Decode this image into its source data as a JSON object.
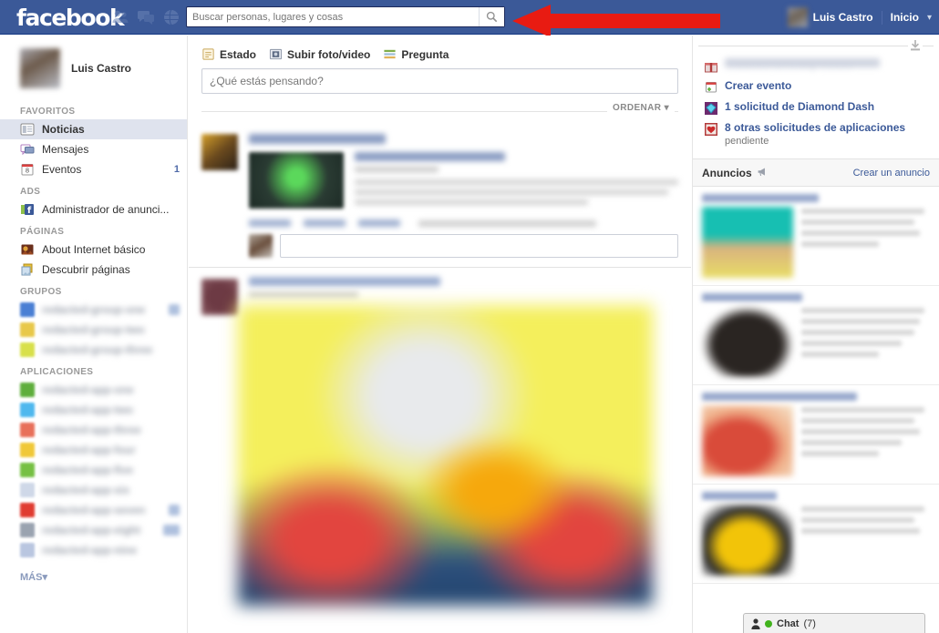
{
  "header": {
    "logo": "facebook",
    "icons": [
      "friends-icon",
      "messages-icon",
      "globe-notifications-icon"
    ],
    "search": {
      "placeholder": "Buscar personas, lugares y cosas",
      "value": "",
      "button_icon": "search-icon"
    },
    "account": {
      "name": "Luis Castro",
      "home_label": "Inicio",
      "caret": "▾"
    },
    "annotation": {
      "type": "red-arrow",
      "points_to": "search-input",
      "color": "#e81b12"
    }
  },
  "sidebar": {
    "profile_name": "Luis Castro",
    "sections": [
      {
        "label": "FAVORITOS",
        "items": [
          {
            "label": "Noticias",
            "icon": "newsfeed-icon",
            "active": true,
            "badge": ""
          },
          {
            "label": "Mensajes",
            "icon": "messages-icon",
            "active": false,
            "badge": ""
          },
          {
            "label": "Eventos",
            "icon": "calendar-icon",
            "active": false,
            "badge": "1"
          }
        ]
      },
      {
        "label": "ADS",
        "items": [
          {
            "label": "Administrador de anunci...",
            "icon": "ads-manager-icon",
            "active": false,
            "badge": ""
          }
        ]
      },
      {
        "label": "PÁGINAS",
        "items": [
          {
            "label": "About Internet básico",
            "icon": "page-thumb-icon",
            "active": false,
            "badge": ""
          },
          {
            "label": "Descubrir páginas",
            "icon": "discover-pages-icon",
            "active": false,
            "badge": ""
          }
        ]
      },
      {
        "label": "GRUPOS",
        "redacted": true,
        "items": [
          {
            "label": "redacted-group-one",
            "icon": "group-icon",
            "swatch": "#4a7fd4",
            "badge": "1"
          },
          {
            "label": "redacted-group-two",
            "icon": "group-icon",
            "swatch": "#e8c84a",
            "badge": ""
          },
          {
            "label": "redacted-group-three",
            "icon": "group-icon",
            "swatch": "#d8e04a",
            "badge": ""
          }
        ]
      },
      {
        "label": "APLICACIONES",
        "redacted": true,
        "items": [
          {
            "label": "redacted-app-one",
            "icon": "app-icon",
            "swatch": "#5fae3c",
            "badge": ""
          },
          {
            "label": "redacted-app-two",
            "icon": "app-icon",
            "swatch": "#4fb8ee",
            "badge": ""
          },
          {
            "label": "redacted-app-three",
            "icon": "app-icon",
            "swatch": "#e8705a",
            "badge": ""
          },
          {
            "label": "redacted-app-four",
            "icon": "app-icon",
            "swatch": "#f0c838",
            "badge": ""
          },
          {
            "label": "redacted-app-five",
            "icon": "app-icon",
            "swatch": "#76c043",
            "badge": ""
          },
          {
            "label": "redacted-app-six",
            "icon": "app-icon",
            "swatch": "#cfd8e8",
            "badge": ""
          },
          {
            "label": "redacted-app-seven",
            "icon": "app-icon",
            "swatch": "#e03c31",
            "badge": "1"
          },
          {
            "label": "redacted-app-eight",
            "icon": "app-icon",
            "swatch": "#9aa3b0",
            "badge": "20"
          },
          {
            "label": "redacted-app-nine",
            "icon": "app-icon",
            "swatch": "#b9c6e0",
            "badge": ""
          }
        ]
      }
    ],
    "more_label": "MÁS"
  },
  "composer": {
    "tabs": [
      {
        "label": "Estado",
        "icon": "status-icon"
      },
      {
        "label": "Subir foto/video",
        "icon": "photo-video-icon"
      },
      {
        "label": "Pregunta",
        "icon": "question-icon"
      }
    ],
    "placeholder": "¿Qué estás pensando?",
    "sort_label": "ORDENAR",
    "sort_caret": "▾"
  },
  "feed": {
    "posts": [
      {
        "author": "redacted-author-name",
        "attachment_title": "redacted-link-title",
        "attachment_subtitle": "redacted-source",
        "actions": [
          "redacted-like",
          "redacted-comment",
          "redacted-share"
        ],
        "meta": "redacted-timestamp",
        "comment_placeholder": "redacted-comment-placeholder"
      },
      {
        "author": "redacted-author-name-2",
        "subtitle": "redacted-timestamp-2",
        "image": "redacted-photo"
      }
    ]
  },
  "right_column": {
    "collapse_icon": "download-icon",
    "requests": [
      {
        "label": "redacted-birthday-notice",
        "icon": "gift-icon",
        "redacted": true,
        "sub": ""
      },
      {
        "label": "Crear evento",
        "icon": "create-event-icon",
        "redacted": false,
        "sub": ""
      },
      {
        "label": "1 solicitud de Diamond Dash",
        "icon": "diamond-icon",
        "redacted": false,
        "sub": ""
      },
      {
        "label": "8 otras solicitudes de aplicaciones",
        "icon": "app-requests-icon",
        "redacted": false,
        "sub": "pendiente"
      }
    ],
    "ads": {
      "title": "Anuncios",
      "title_icon": "megaphone-icon",
      "create_label": "Crear un anuncio",
      "items": [
        {
          "title": "redacted-ad-title-1",
          "image": "redacted-ad-image-1"
        },
        {
          "title": "redacted-ad-title-2",
          "image": "redacted-ad-image-2"
        },
        {
          "title": "redacted-ad-title-3",
          "image": "redacted-ad-image-3"
        },
        {
          "title": "redacted-ad-title-4",
          "image": "redacted-ad-image-4"
        }
      ]
    }
  },
  "chat": {
    "label": "Chat",
    "count": "(7)",
    "status": "online"
  }
}
